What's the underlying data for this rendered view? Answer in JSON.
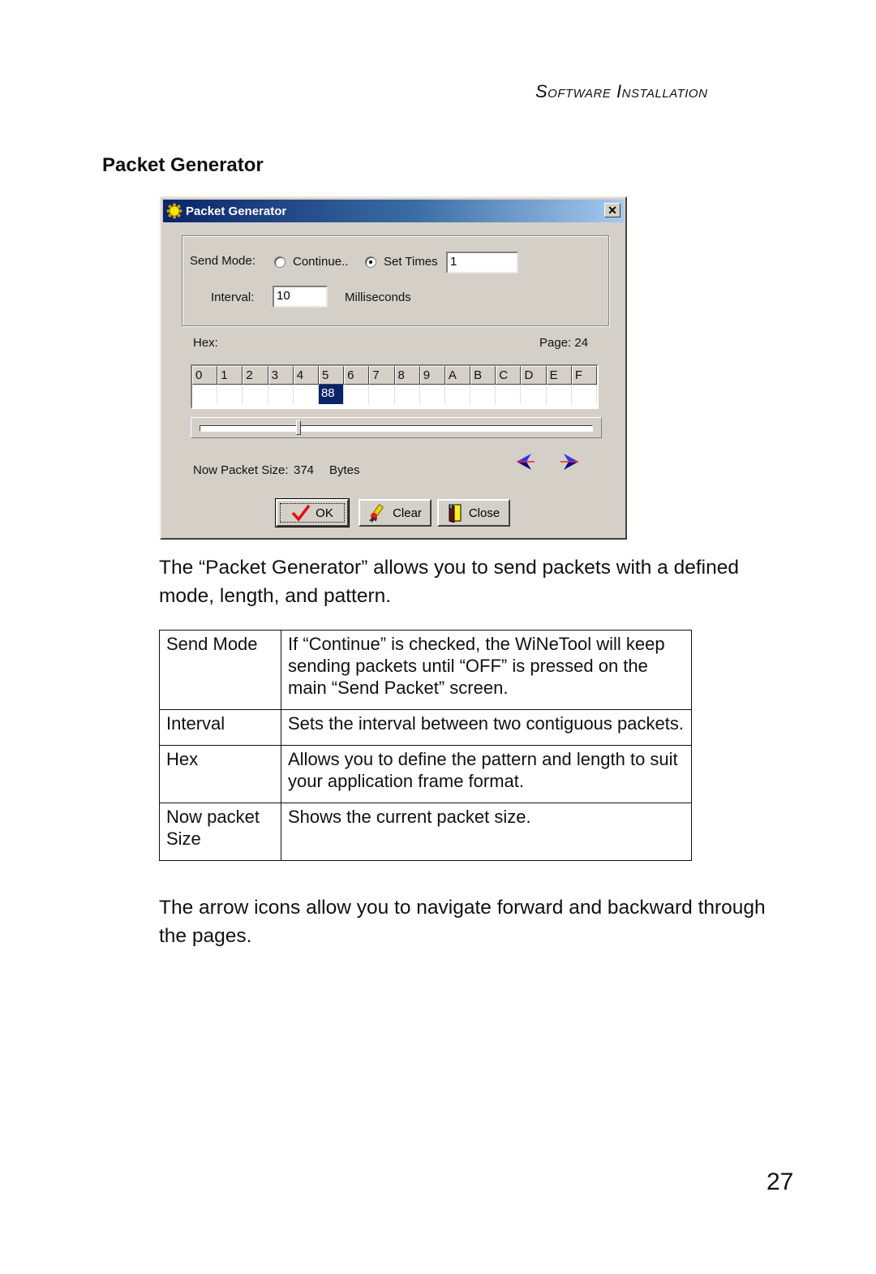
{
  "running_header": "Software Installation",
  "section_title": "Packet Generator",
  "dialog": {
    "title": "Packet Generator",
    "title_icon": "sun-gear-icon",
    "close_label": "✕",
    "send_mode": {
      "label": "Send Mode:",
      "options": [
        {
          "label": "Continue..",
          "checked": false
        },
        {
          "label": "Set Times",
          "checked": true
        }
      ],
      "set_times_value": "1"
    },
    "interval": {
      "label": "Interval:",
      "value": "10",
      "unit": "Milliseconds"
    },
    "hex": {
      "label": "Hex:",
      "page_label": "Page: 24",
      "columns": [
        "0",
        "1",
        "2",
        "3",
        "4",
        "5",
        "6",
        "7",
        "8",
        "9",
        "A",
        "B",
        "C",
        "D",
        "E",
        "F"
      ],
      "values": [
        "",
        "",
        "",
        "",
        "",
        "88",
        "",
        "",
        "",
        "",
        "",
        "",
        "",
        "",
        "",
        ""
      ],
      "selected_index": 5
    },
    "slider_position_fraction": 0.25,
    "packet_size": {
      "label": "Now Packet Size:",
      "value": "374",
      "unit": "Bytes"
    },
    "nav": {
      "prev_icon": "arrow-left-icon",
      "next_icon": "arrow-right-icon"
    },
    "buttons": {
      "ok": "OK",
      "clear": "Clear",
      "close": "Close"
    },
    "colors": {
      "face": "#d4d0c8",
      "title_start": "#0a246a",
      "title_end": "#a6caf0",
      "selection": "#0a246a",
      "arrow": "#1010d0"
    }
  },
  "intro_text": "The “Packet Generator” allows you to send packets with a defined mode, length, and pattern.",
  "table": {
    "rows": [
      {
        "term": "Send Mode",
        "description": "If “Continue” is checked, the WiNeTool will keep sending packets until “OFF” is pressed on the main “Send Packet” screen."
      },
      {
        "term": "Interval",
        "description": "Sets the interval between two contiguous packets."
      },
      {
        "term": "Hex",
        "description": "Allows you to define the pattern and length to suit your application frame format."
      },
      {
        "term": "Now packet Size",
        "description": "Shows the current packet size."
      }
    ]
  },
  "outro_text": "The arrow icons allow you to navigate forward and backward through the pages.",
  "page_number": "27"
}
